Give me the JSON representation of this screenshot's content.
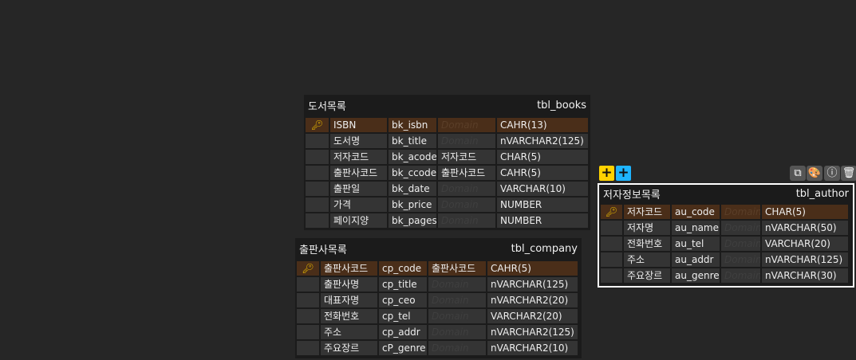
{
  "tables": {
    "books": {
      "title": "도서목록",
      "name": "tbl_books",
      "rows": [
        [
          "ISBN",
          "bk_isbn",
          "Domain",
          "CAHR(13)"
        ],
        [
          "도서명",
          "bk_title",
          "Domain",
          "nVARCHAR2(125)"
        ],
        [
          "저자코드",
          "bk_acode",
          "저자코드",
          "CHAR(5)"
        ],
        [
          "출판사코드",
          "bk_ccode",
          "출판사코드",
          "CAHR(5)"
        ],
        [
          "출판일",
          "bk_date",
          "Domain",
          "VARCHAR(10)"
        ],
        [
          "가격",
          "bk_price",
          "Domain",
          "NUMBER"
        ],
        [
          "페이지양",
          "bk_pages",
          "Domain",
          "NUMBER"
        ]
      ]
    },
    "company": {
      "title": "출판사목록",
      "name": "tbl_company",
      "rows": [
        [
          "출판사코드",
          "cp_code",
          "출판사코드",
          "CAHR(5)"
        ],
        [
          "출판사명",
          "cp_title",
          "Domain",
          "nVARCHAR(125)"
        ],
        [
          "대표자명",
          "cp_ceo",
          "Domain",
          "nVARCHAR2(20)"
        ],
        [
          "전화번호",
          "cp_tel",
          "Domain",
          "VARCHAR2(20)"
        ],
        [
          "주소",
          "cp_addr",
          "Domain",
          "nVARCHAR2(125)"
        ],
        [
          "주요장르",
          "cP_genre",
          "Domain",
          "nVARCHAR2(10)"
        ]
      ]
    },
    "author": {
      "title": "저자정보목록",
      "name": "tbl_author",
      "rows": [
        [
          "저자코드",
          "au_code",
          "Domain",
          "CHAR(5)"
        ],
        [
          "저자명",
          "au_name",
          "Domain",
          "nVARCHAR(50)"
        ],
        [
          "전화번호",
          "au_tel",
          "Domain",
          "VARCHAR(20)"
        ],
        [
          "주소",
          "au_addr",
          "Domain",
          "nVARCHAR(125)"
        ],
        [
          "주요장르",
          "au_genre",
          "Domain",
          "nVARCHAR(30)"
        ]
      ]
    }
  },
  "toolbar": {
    "add1": "+",
    "add2": "+",
    "icons": [
      "copy-icon",
      "palette-icon",
      "info-icon",
      "trash-icon"
    ]
  },
  "colors": {
    "pk_row": "#4a2e19",
    "key": "#e8b800",
    "add_yellow": "#ffd200",
    "add_blue": "#1eb4ff"
  }
}
